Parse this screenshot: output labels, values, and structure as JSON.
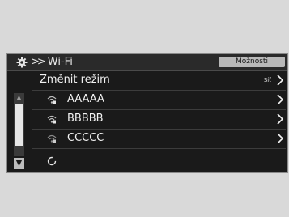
{
  "header": {
    "breadcrumb": "Wi-Fi",
    "options_label": "Možnosti"
  },
  "list": {
    "mode_row": {
      "label": "Změnit režim",
      "value": "Síť"
    },
    "networks": [
      {
        "ssid": "AAAAA"
      },
      {
        "ssid": "BBBBB"
      },
      {
        "ssid": "CCCCC"
      }
    ]
  },
  "scrollbar": {
    "position": 0
  },
  "icons": {
    "settings": "gear-icon",
    "wifi": "wifi-signal-icon",
    "chevron": "chevron-right-icon",
    "loading": "spinner-icon",
    "scroll_up": "scroll-up-icon",
    "scroll_down": "scroll-down-icon"
  },
  "colors": {
    "screen_bg": "#1a1a1a",
    "text": "#f2f2f2",
    "button_bg": "#b9b9b9"
  }
}
